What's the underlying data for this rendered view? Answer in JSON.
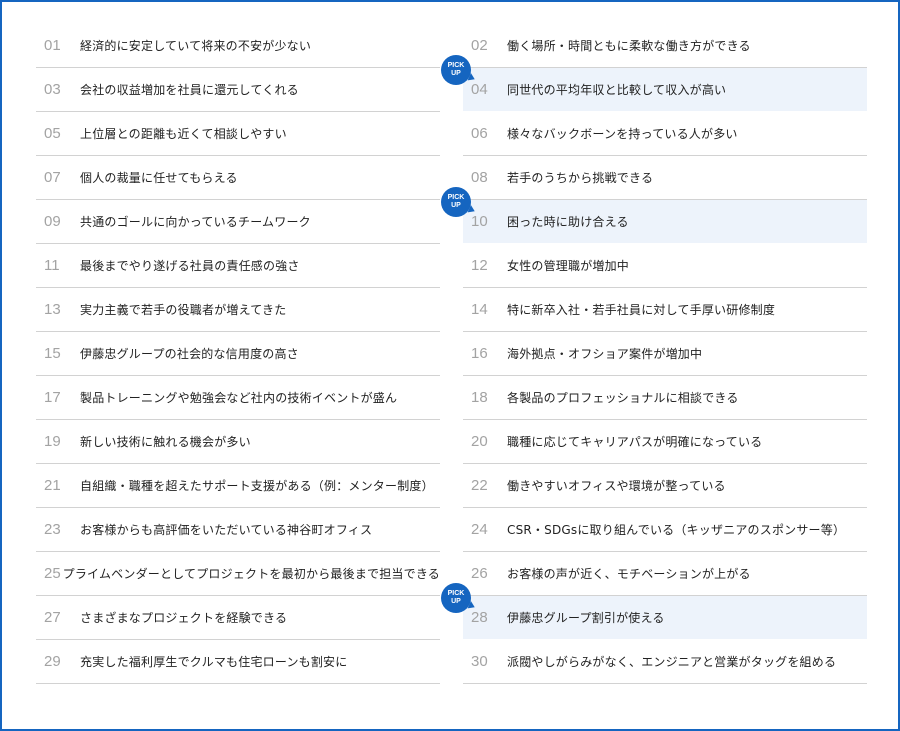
{
  "pickup": {
    "line1": "PICK",
    "line2": "UP"
  },
  "left": [
    {
      "num": "01",
      "text": "経済的に安定していて将来の不安が少ない"
    },
    {
      "num": "03",
      "text": "会社の収益増加を社員に還元してくれる"
    },
    {
      "num": "05",
      "text": "上位層との距離も近くて相談しやすい"
    },
    {
      "num": "07",
      "text": "個人の裁量に任せてもらえる"
    },
    {
      "num": "09",
      "text": "共通のゴールに向かっているチームワーク"
    },
    {
      "num": "11",
      "text": "最後までやり遂げる社員の責任感の強さ"
    },
    {
      "num": "13",
      "text": "実力主義で若手の役職者が増えてきた"
    },
    {
      "num": "15",
      "text": "伊藤忠グループの社会的な信用度の高さ"
    },
    {
      "num": "17",
      "text": "製品トレーニングや勉強会など社内の技術イベントが盛ん"
    },
    {
      "num": "19",
      "text": "新しい技術に触れる機会が多い"
    },
    {
      "num": "21",
      "text": "自組織・職種を超えたサポート支援がある（例：メンター制度）"
    },
    {
      "num": "23",
      "text": "お客様からも高評価をいただいている神谷町オフィス"
    },
    {
      "num": "25",
      "text": "プライムベンダーとしてプロジェクトを最初から最後まで担当できる"
    },
    {
      "num": "27",
      "text": "さまざまなプロジェクトを経験できる"
    },
    {
      "num": "29",
      "text": "充実した福利厚生でクルマも住宅ローンも割安に"
    }
  ],
  "right": [
    {
      "num": "02",
      "text": "働く場所・時間ともに柔軟な働き方ができる"
    },
    {
      "num": "04",
      "text": "同世代の平均年収と比較して収入が高い"
    },
    {
      "num": "06",
      "text": "様々なバックボーンを持っている人が多い"
    },
    {
      "num": "08",
      "text": "若手のうちから挑戦できる"
    },
    {
      "num": "10",
      "text": "困った時に助け合える"
    },
    {
      "num": "12",
      "text": "女性の管理職が増加中"
    },
    {
      "num": "14",
      "text": "特に新卒入社・若手社員に対して手厚い研修制度"
    },
    {
      "num": "16",
      "text": "海外拠点・オフショア案件が増加中"
    },
    {
      "num": "18",
      "text": "各製品のプロフェッショナルに相談できる"
    },
    {
      "num": "20",
      "text": "職種に応じてキャリアパスが明確になっている"
    },
    {
      "num": "22",
      "text": "働きやすいオフィスや環境が整っている"
    },
    {
      "num": "24",
      "text": "CSR・SDGsに取り組んでいる（キッザニアのスポンサー等）"
    },
    {
      "num": "26",
      "text": "お客様の声が近く、モチベーションが上がる"
    },
    {
      "num": "28",
      "text": "伊藤忠グループ割引が使える"
    },
    {
      "num": "30",
      "text": "派閥やしがらみがなく、エンジニアと営業がタッグを組める"
    }
  ],
  "colors": {
    "accent": "#1565c0",
    "highlight_bg": "#edf3fb",
    "number": "#a3a3a3",
    "text": "#222222",
    "divider": "#d2d2d2"
  }
}
